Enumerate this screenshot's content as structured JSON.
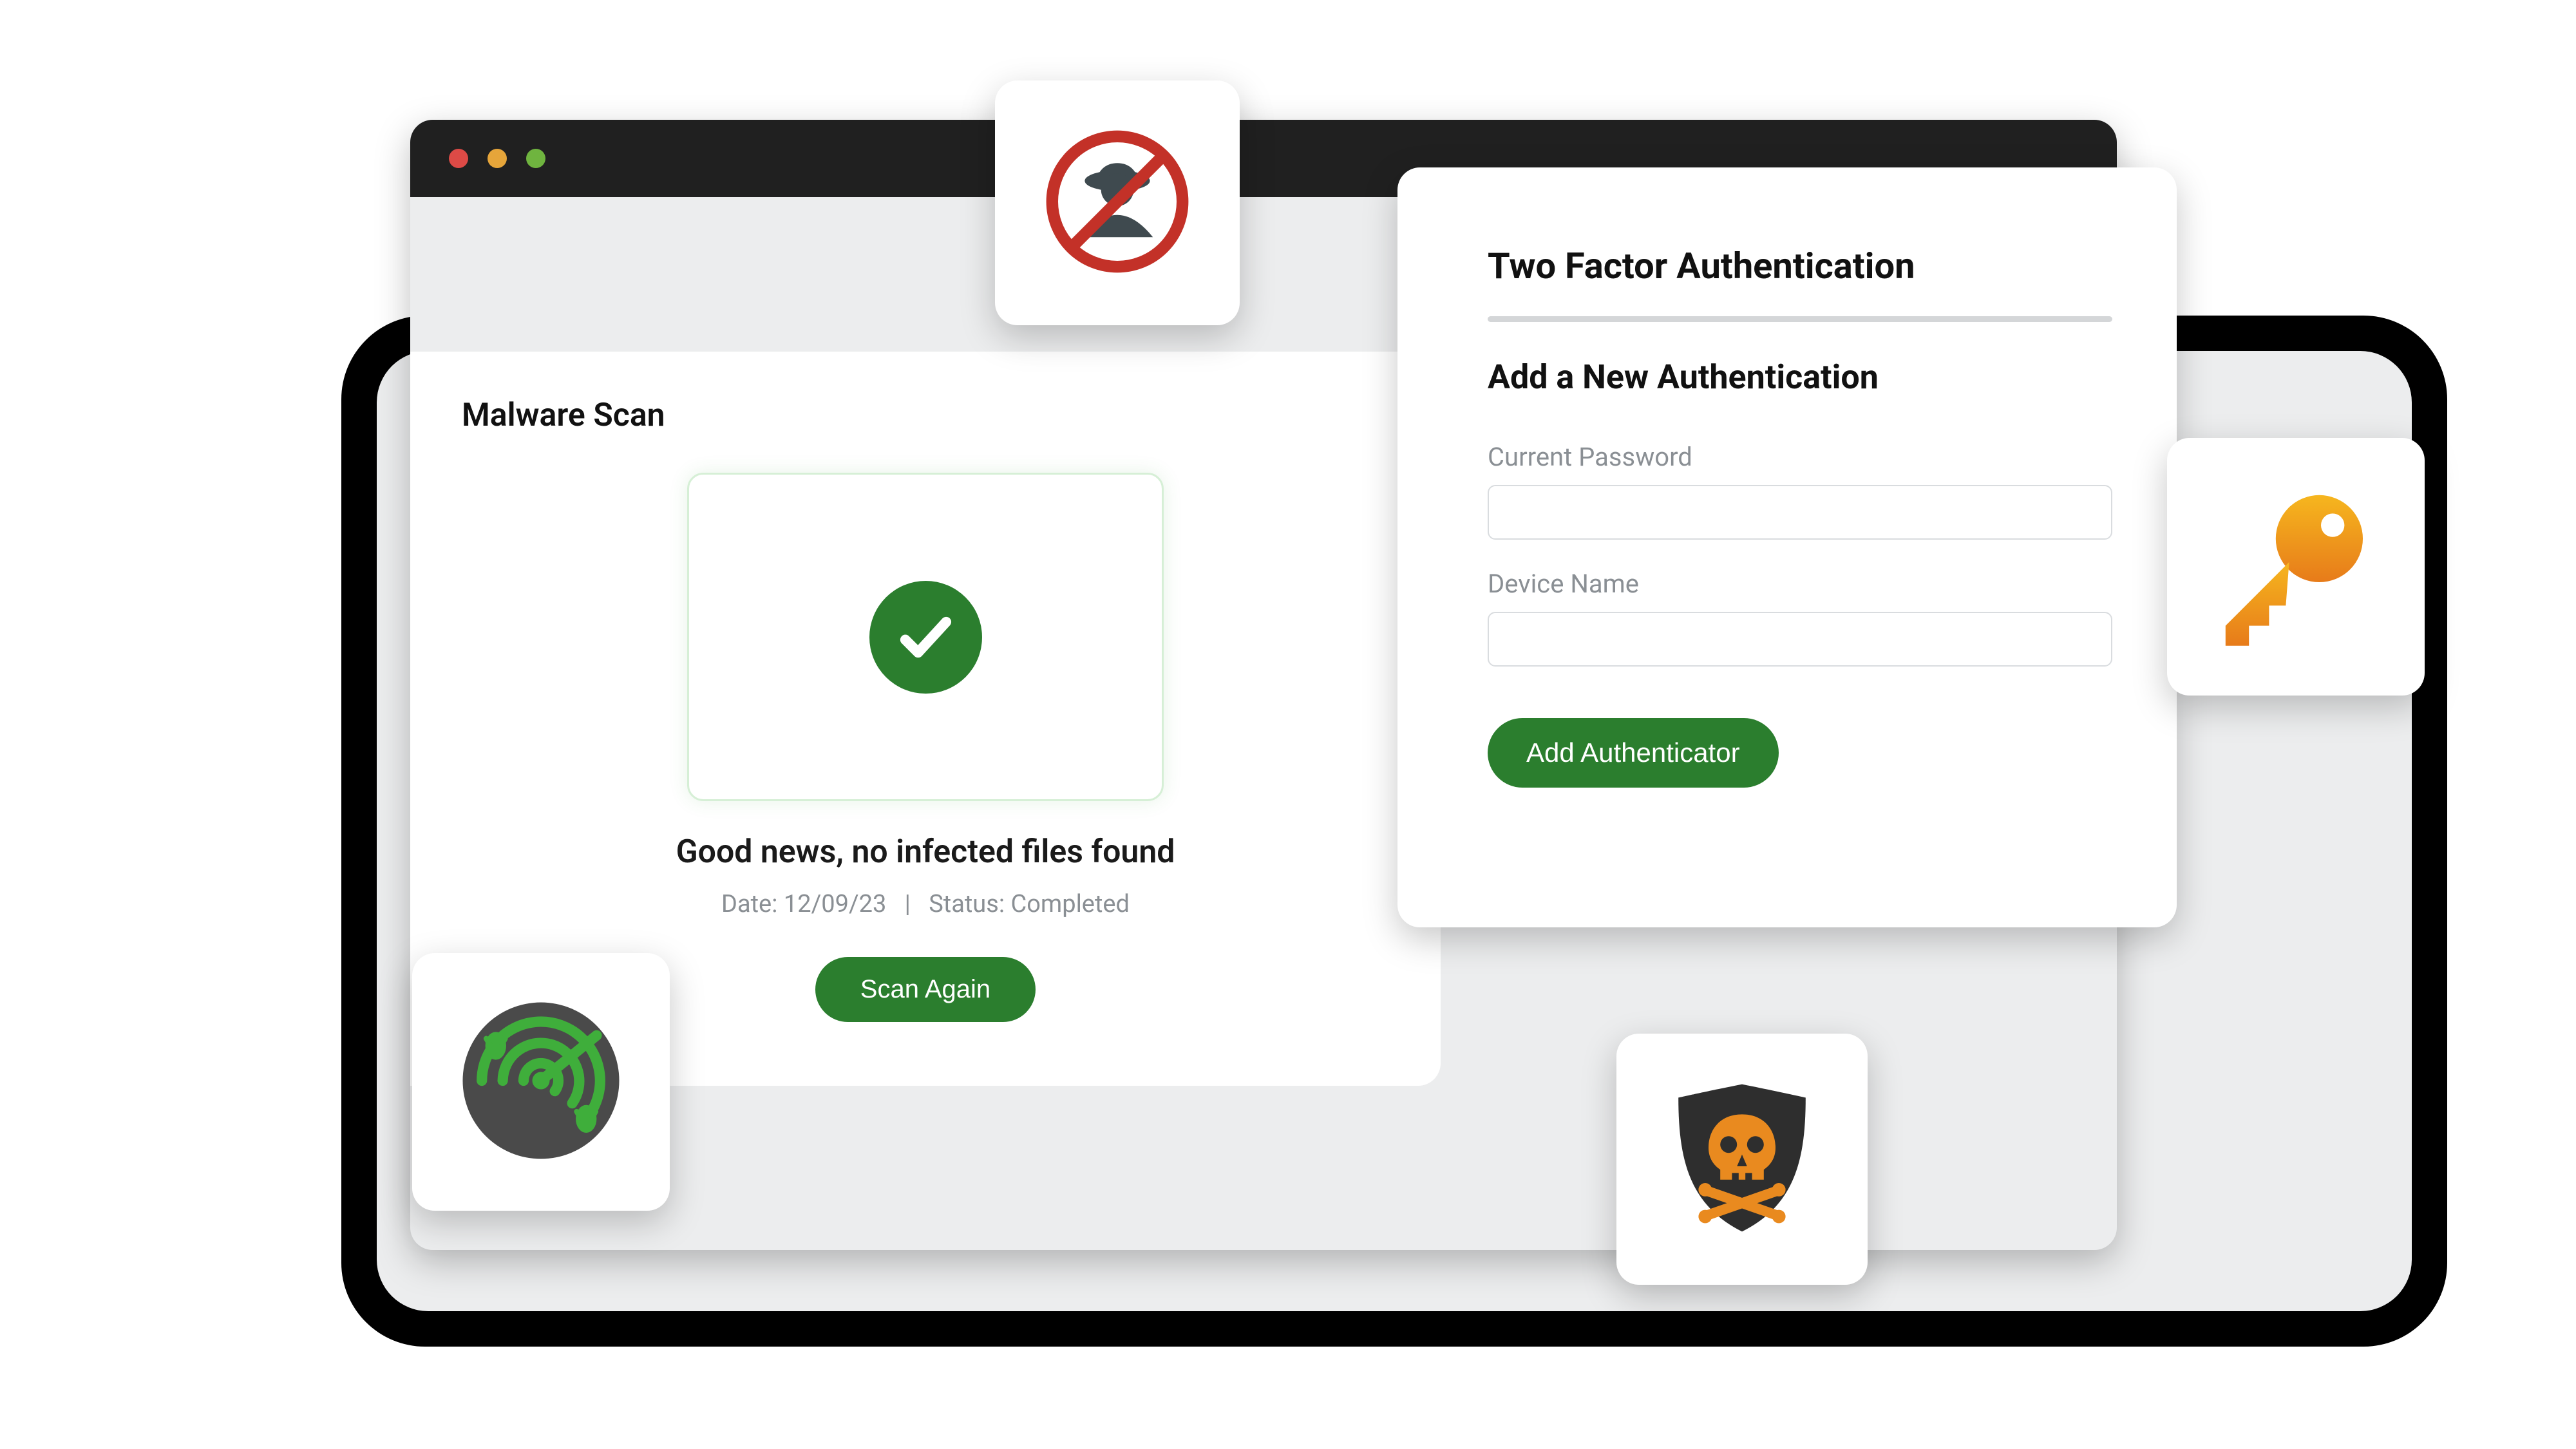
{
  "malware": {
    "title": "Malware Scan",
    "headline": "Good news, no infected files found",
    "meta_date_label": "Date:",
    "meta_date_value": "12/09/23",
    "meta_status_label": "Status:",
    "meta_status_value": "Completed",
    "scan_button": "Scan Again"
  },
  "twofa": {
    "title": "Two Factor Authentication",
    "subtitle": "Add a New Authentication",
    "current_password_label": "Current Password",
    "current_password_value": "",
    "device_name_label": "Device Name",
    "device_name_value": "",
    "add_button": "Add Authenticator"
  },
  "icons": {
    "nospy": "no-spy-icon",
    "radar": "radar-scan-icon",
    "shield": "shield-skull-icon",
    "key": "key-icon",
    "check": "checkmark-icon",
    "traffic_red": "traffic-close-icon",
    "traffic_yellow": "traffic-minimize-icon",
    "traffic_green": "traffic-maximize-icon"
  },
  "colors": {
    "brand_green": "#2b7e2e",
    "text_muted": "#8a8f94"
  }
}
